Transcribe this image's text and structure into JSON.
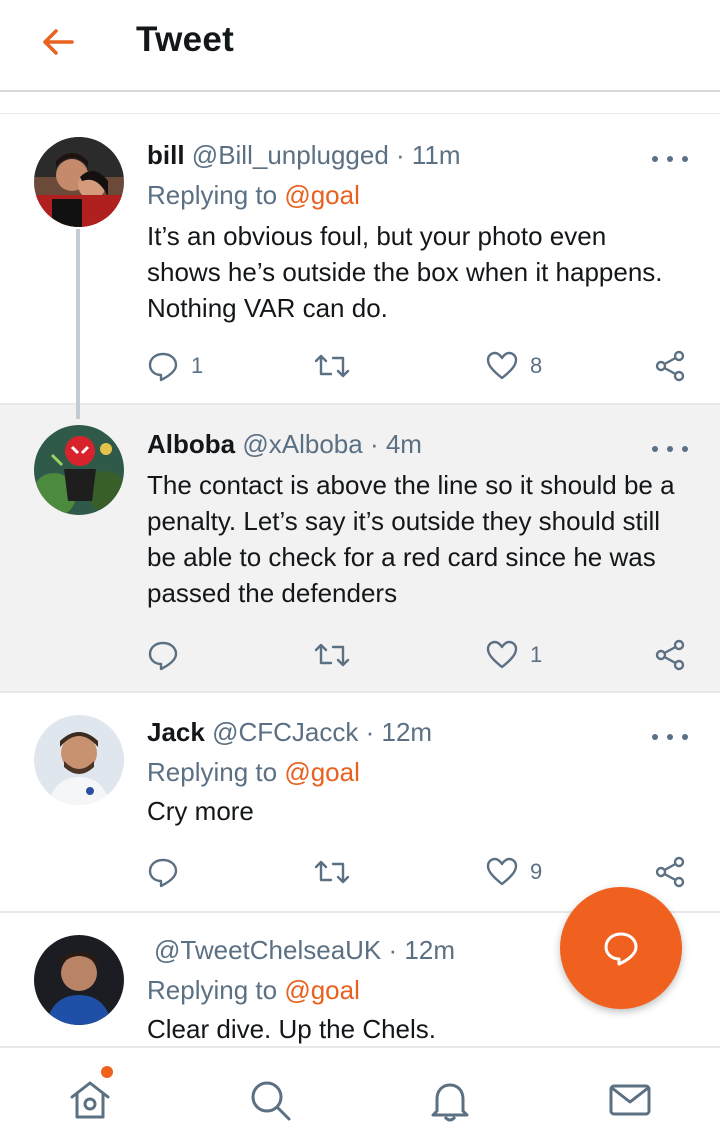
{
  "header": {
    "title": "Tweet",
    "back_icon": "arrow-left-icon"
  },
  "colors": {
    "accent": "#f0611f",
    "mention": "#e8611f",
    "meta": "#5b7083",
    "text": "#14171a",
    "highlight_bg": "#f2f2f2"
  },
  "tweets": [
    {
      "name": "bill",
      "handle": "@Bill_unplugged",
      "time": "· 11m",
      "replying_prefix": "Replying to ",
      "replying_to": "@goal",
      "text": "It’s an obvious foul, but your photo even shows he’s outside the box when it happens. Nothing VAR can do.",
      "replies": "1",
      "retweets": "",
      "likes": "8"
    },
    {
      "name": "Alboba",
      "handle": "@xAlboba",
      "time": "· 4m",
      "text": "The contact is above the line so it should be a penalty. Let’s say it’s outside they should still be able to check for a red card since he was passed the defenders",
      "replies": "",
      "retweets": "",
      "likes": "1"
    },
    {
      "name": "Jack",
      "handle": "@CFCJacck",
      "time": "· 12m",
      "replying_prefix": "Replying to ",
      "replying_to": "@goal",
      "text": "Cry more",
      "replies": "",
      "retweets": "",
      "likes": "9"
    },
    {
      "name": "",
      "handle": "@TweetChelseaUK",
      "time": "· 12m",
      "replying_prefix": "Replying to ",
      "replying_to": "@goal",
      "text": "Clear dive. Up the Chels."
    }
  ],
  "fab": {
    "icon": "compose-reply-icon"
  },
  "bottom_nav": {
    "items": [
      "home-icon",
      "search-icon",
      "bell-icon",
      "mail-icon"
    ]
  }
}
